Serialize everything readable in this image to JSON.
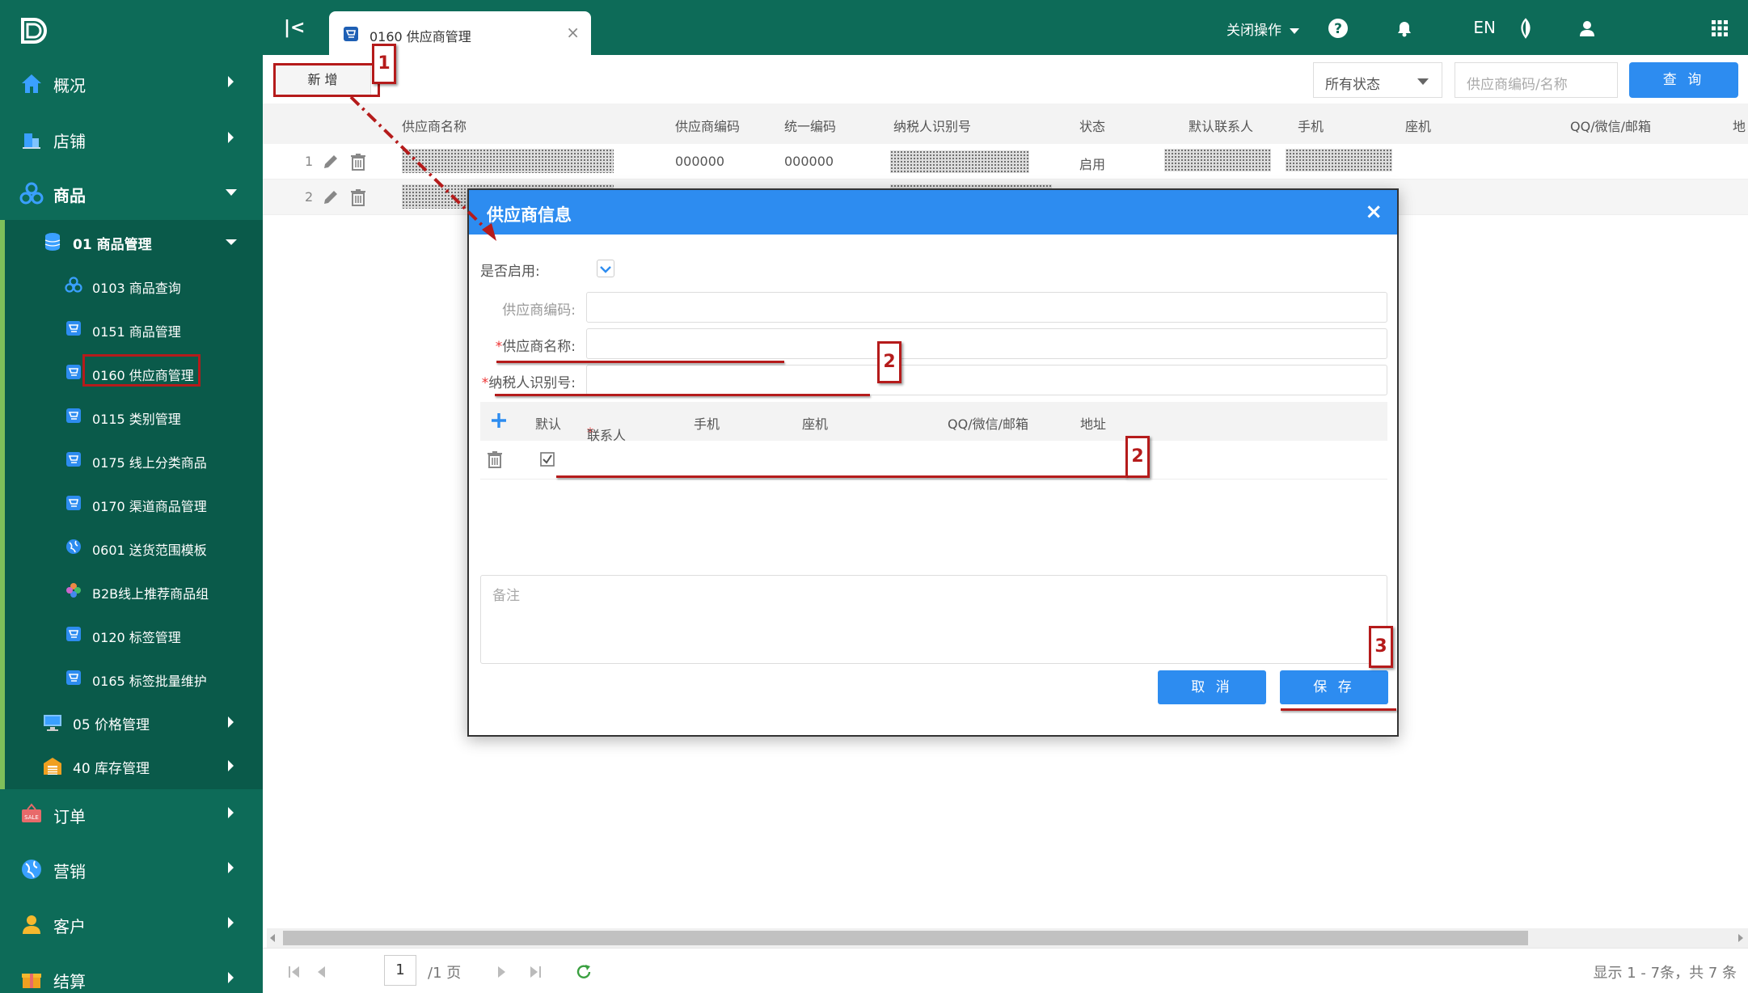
{
  "sidebar": {
    "top": [
      {
        "label": "概况",
        "icon": "home-icon"
      },
      {
        "label": "店铺",
        "icon": "building-icon"
      },
      {
        "label": "商品",
        "icon": "cubes-icon"
      },
      {
        "label": "订单",
        "icon": "sale-tag-icon"
      },
      {
        "label": "营销",
        "icon": "globe-icon"
      },
      {
        "label": "客户",
        "icon": "user-icon"
      },
      {
        "label": "结算",
        "icon": "gift-icon"
      }
    ],
    "group": {
      "label": "01 商品管理",
      "icon": "database-icon"
    },
    "items": [
      {
        "label": "0103 商品查询",
        "icon": "cubes-icon"
      },
      {
        "label": "0151 商品管理",
        "icon": "cart-icon"
      },
      {
        "label": "0160 供应商管理",
        "icon": "cart-icon"
      },
      {
        "label": "0115 类别管理",
        "icon": "cart-icon"
      },
      {
        "label": "0175 线上分类商品",
        "icon": "cart-icon"
      },
      {
        "label": "0170 渠道商品管理",
        "icon": "cart-icon"
      },
      {
        "label": "0601 送货范围模板",
        "icon": "globe-icon"
      },
      {
        "label": "B2B线上推荐商品组",
        "icon": "color-wheel-icon"
      },
      {
        "label": "0120 标签管理",
        "icon": "cart-icon"
      },
      {
        "label": "0165 标签批量维护",
        "icon": "cart-icon"
      }
    ],
    "groups_after": [
      {
        "label": "05 价格管理",
        "icon": "monitor-icon"
      },
      {
        "label": "40 库存管理",
        "icon": "warehouse-icon"
      }
    ]
  },
  "topbar": {
    "tab_label": "0160 供应商管理",
    "tab_close": "×",
    "close_ops": "关闭操作",
    "lang": "EN"
  },
  "toolbar": {
    "add_label": "新 增",
    "status_select": "所有状态",
    "search_placeholder": "供应商编码/名称",
    "query_label": "查 询"
  },
  "grid": {
    "columns": [
      "供应商名称",
      "供应商编码",
      "统一编码",
      "纳税人识别号",
      "状态",
      "默认联系人",
      "手机",
      "座机",
      "QQ/微信/邮箱",
      "地"
    ],
    "rows": [
      {
        "no": "1",
        "code": "000000",
        "unified": "000000",
        "status": "启用"
      },
      {
        "no": "2",
        "code": "",
        "unified": "",
        "status": ""
      }
    ]
  },
  "pager": {
    "page": "1",
    "total_pages": "/1 页",
    "info": "显示 1 - 7条，共 7 条"
  },
  "modal": {
    "title": "供应商信息",
    "close": "×",
    "enabled_label": "是否启用:",
    "code_label": "供应商编码:",
    "name_label": "供应商名称:",
    "tax_label": "纳税人识别号:",
    "required_mark": "*",
    "contact_cols": {
      "default": "默认",
      "contact": "联系人",
      "mobile": "手机",
      "phone": "座机",
      "im": "QQ/微信/邮箱",
      "address": "地址"
    },
    "remark_placeholder": "备注",
    "cancel_label": "取 消",
    "save_label": "保 存"
  },
  "annotations": [
    "1",
    "2",
    "2",
    "3"
  ],
  "colors": {
    "sidebar": "#0d6b58",
    "accent": "#2d8cf0",
    "annotation": "#b51b1b"
  }
}
